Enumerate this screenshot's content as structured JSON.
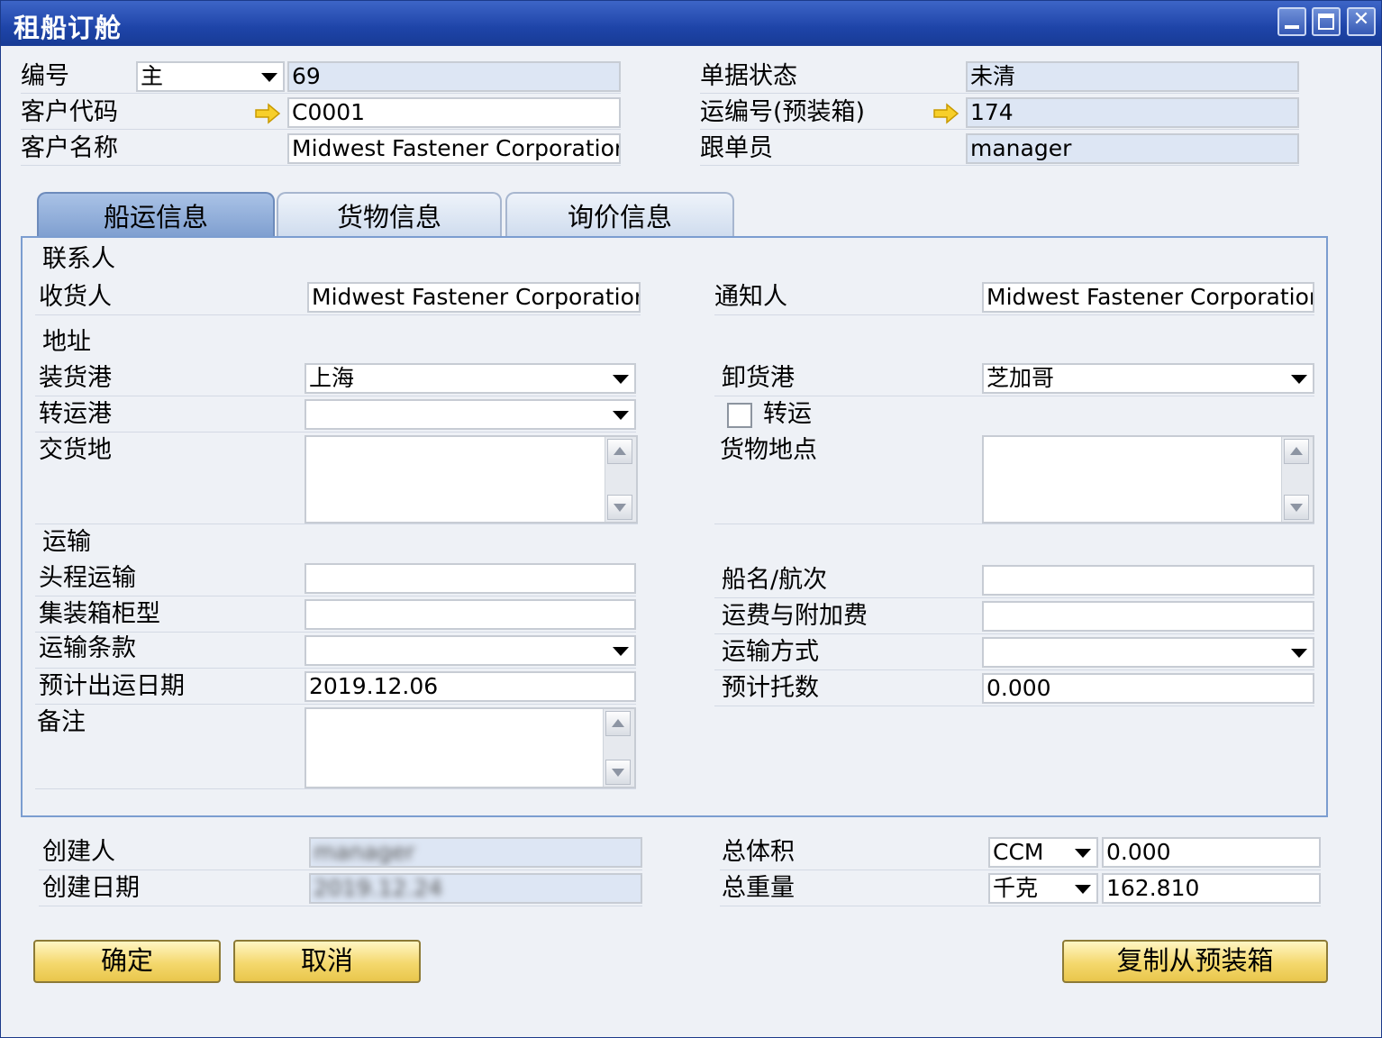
{
  "window": {
    "title": "租船订舱"
  },
  "header": {
    "number_label": "编号",
    "number_series": "主",
    "number_value": "69",
    "customer_code_label": "客户代码",
    "customer_code_value": "C0001",
    "customer_name_label": "客户名称",
    "customer_name_value": "Midwest Fastener Corporation",
    "doc_status_label": "单据状态",
    "doc_status_value": "未清",
    "ship_no_label": "运编号(预装箱)",
    "ship_no_value": "174",
    "follower_label": "跟单员",
    "follower_value": "manager"
  },
  "tabs": [
    {
      "label": "船运信息",
      "active": true
    },
    {
      "label": "货物信息",
      "active": false
    },
    {
      "label": "询价信息",
      "active": false
    }
  ],
  "shipping": {
    "contact_section": "联系人",
    "consignee_label": "收货人",
    "consignee_value": "Midwest Fastener Corporation",
    "notify_label": "通知人",
    "notify_value": "Midwest Fastener Corporation",
    "address_section": "地址",
    "port_loading_label": "装货港",
    "port_loading_value": "上海",
    "port_discharge_label": "卸货港",
    "port_discharge_value": "芝加哥",
    "port_transit_label": "转运港",
    "port_transit_value": "",
    "transship_label": "转运",
    "transship_checked": false,
    "delivery_place_label": "交货地",
    "goods_location_label": "货物地点",
    "transport_section": "运输",
    "pre_carriage_label": "头程运输",
    "pre_carriage_value": "",
    "vessel_label": "船名/航次",
    "vessel_value": "",
    "container_type_label": "集装箱柜型",
    "container_type_value": "",
    "freight_label": "运费与附加费",
    "freight_value": "",
    "terms_label": "运输条款",
    "terms_value": "",
    "mode_label": "运输方式",
    "mode_value": "",
    "etd_label": "预计出运日期",
    "etd_value": "2019.12.06",
    "pallets_label": "预计托数",
    "pallets_value": "0.000",
    "remarks_label": "备注"
  },
  "footer": {
    "creator_label": "创建人",
    "creator_value": "manager",
    "created_date_label": "创建日期",
    "created_date_value": "2019.12.24",
    "total_volume_label": "总体积",
    "volume_unit": "CCM",
    "volume_value": "0.000",
    "total_weight_label": "总重量",
    "weight_unit": "千克",
    "weight_value": "162.810"
  },
  "buttons": {
    "ok": "确定",
    "cancel": "取消",
    "copy_from": "复制从预装箱"
  },
  "icons": {
    "link_arrow_color": "#f5c400"
  }
}
